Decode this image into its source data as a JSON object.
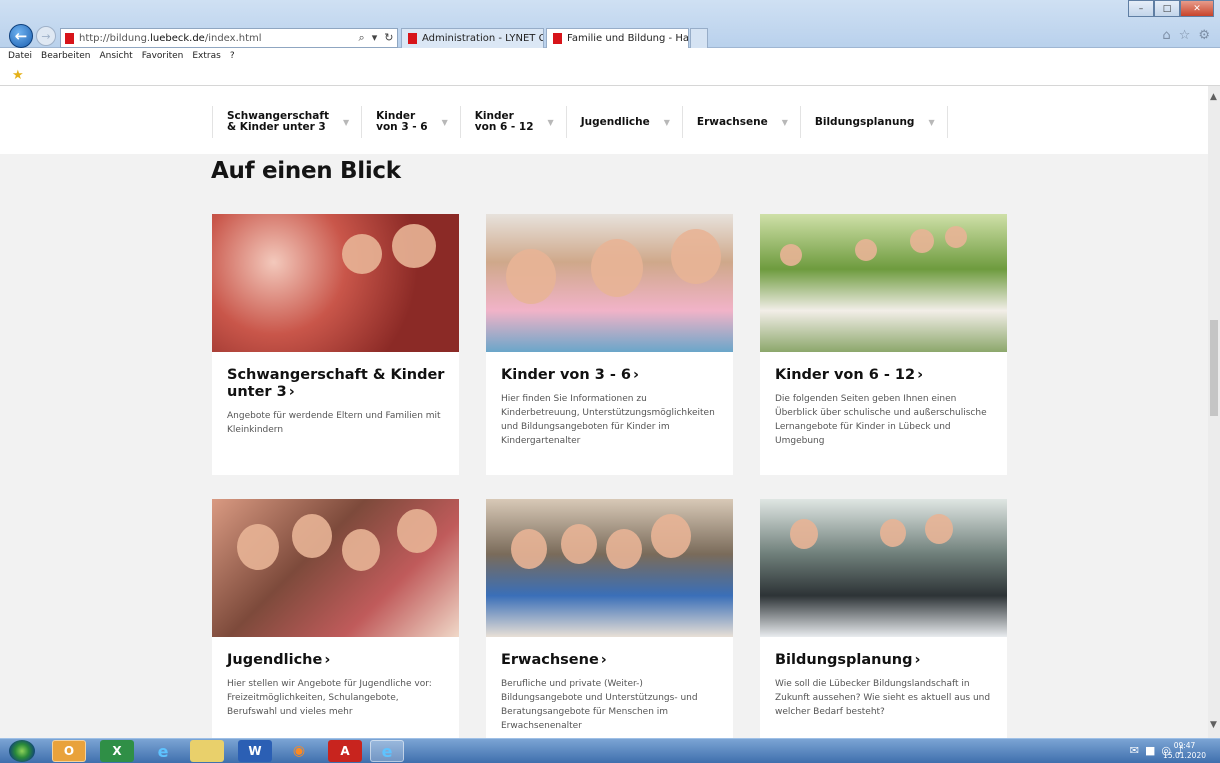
{
  "browser": {
    "address": {
      "prefix": "http://bildung.",
      "domain": "luebeck.de",
      "suffix": "/index.html"
    },
    "tabs": [
      {
        "label": "Administration - LYNET Conte..."
      },
      {
        "label": "Familie und Bildung - Hans...",
        "close": "×"
      }
    ],
    "menu": [
      "Datei",
      "Bearbeiten",
      "Ansicht",
      "Favoriten",
      "Extras",
      "?"
    ]
  },
  "nav": {
    "items": [
      {
        "label": "Schwangerschaft\n& Kinder unter 3"
      },
      {
        "label": "Kinder\nvon 3 - 6"
      },
      {
        "label": "Kinder\nvon 6 - 12"
      },
      {
        "label": "Jugendliche"
      },
      {
        "label": "Erwachsene"
      },
      {
        "label": "Bildungsplanung"
      }
    ]
  },
  "page": {
    "title": "Auf einen Blick",
    "cards": [
      {
        "title": "Schwangerschaft & Kinder unter 3",
        "text": "Angebote für werdende Eltern und Familien mit Kleinkindern"
      },
      {
        "title": "Kinder von 3 - 6",
        "text": "Hier finden Sie Informationen zu Kinderbetreuung, Unterstützungsmöglichkeiten und Bildungsangeboten für Kinder im Kindergartenalter"
      },
      {
        "title": "Kinder von 6 - 12",
        "text": "Die folgenden Seiten geben Ihnen einen Überblick über schulische und außerschulische Lernangebote für Kinder in Lübeck und Umgebung"
      },
      {
        "title": "Jugendliche",
        "text": "Hier stellen wir Angebote für Jugendliche vor: Freizeitmöglichkeiten, Schulangebote, Berufswahl und vieles mehr"
      },
      {
        "title": "Erwachsene",
        "text": "Berufliche und private (Weiter-) Bildungsangebote und Unterstützungs- und Beratungsangebote für Menschen im Erwachsenenalter"
      },
      {
        "title": "Bildungsplanung",
        "text": "Wie soll die Lübecker Bildungslandschaft in Zukunft aussehen? Wie sieht es aktuell aus und welcher Bedarf besteht?"
      }
    ]
  },
  "taskbar": {
    "clock": {
      "time": "09:47",
      "date": "15.01.2020"
    }
  },
  "icons": [
    "back-arrow-icon",
    "forward-arrow-icon",
    "search-icon",
    "refresh-icon",
    "home-icon",
    "star-icon",
    "gear-icon",
    "favorites-star-icon",
    "chevron-down-icon"
  ]
}
